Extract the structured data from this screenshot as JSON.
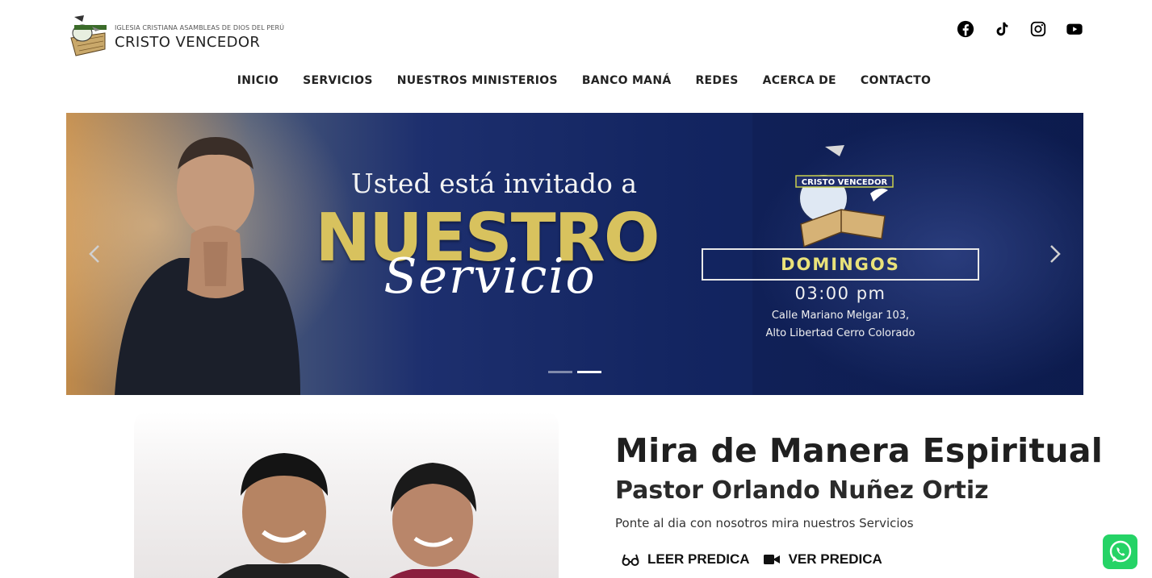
{
  "header": {
    "logo_subtitle": "IGLESIA CRISTIANA ASAMBLEAS DE DIOS DEL PERÚ",
    "logo_title": "CRISTO VENCEDOR",
    "social_icons": [
      "facebook-icon",
      "tiktok-icon",
      "instagram-icon",
      "youtube-icon"
    ]
  },
  "nav": {
    "items": [
      "INICIO",
      "SERVICIOS",
      "NUESTROS MINISTERIOS",
      "BANCO MANÁ",
      "REDES",
      "ACERCA DE",
      "CONTACTO"
    ]
  },
  "hero": {
    "invite": "Usted está invitado a",
    "headline": "NUESTRO",
    "script": "Servicio",
    "day": "DOMINGOS",
    "time": "03:00 pm",
    "address_line1": "Calle Mariano Melgar 103,",
    "address_line2": "Alto Libertad Cerro Colorado",
    "church_logo_text": "CRISTO VENCEDOR",
    "slide_count": 2,
    "active_slide": 2
  },
  "pastor": {
    "title": "Mira de Manera Espiritual",
    "name": "Pastor Orlando Nuñez Ortiz",
    "description": "Ponte al dia con nosotros mira nuestros Servicios",
    "read_label": "LEER PREDICA",
    "watch_label": "VER PREDICA"
  },
  "colors": {
    "hero_navy": "#132561",
    "headline_gold": "#d8c25e",
    "whatsapp_green": "#25d366"
  }
}
